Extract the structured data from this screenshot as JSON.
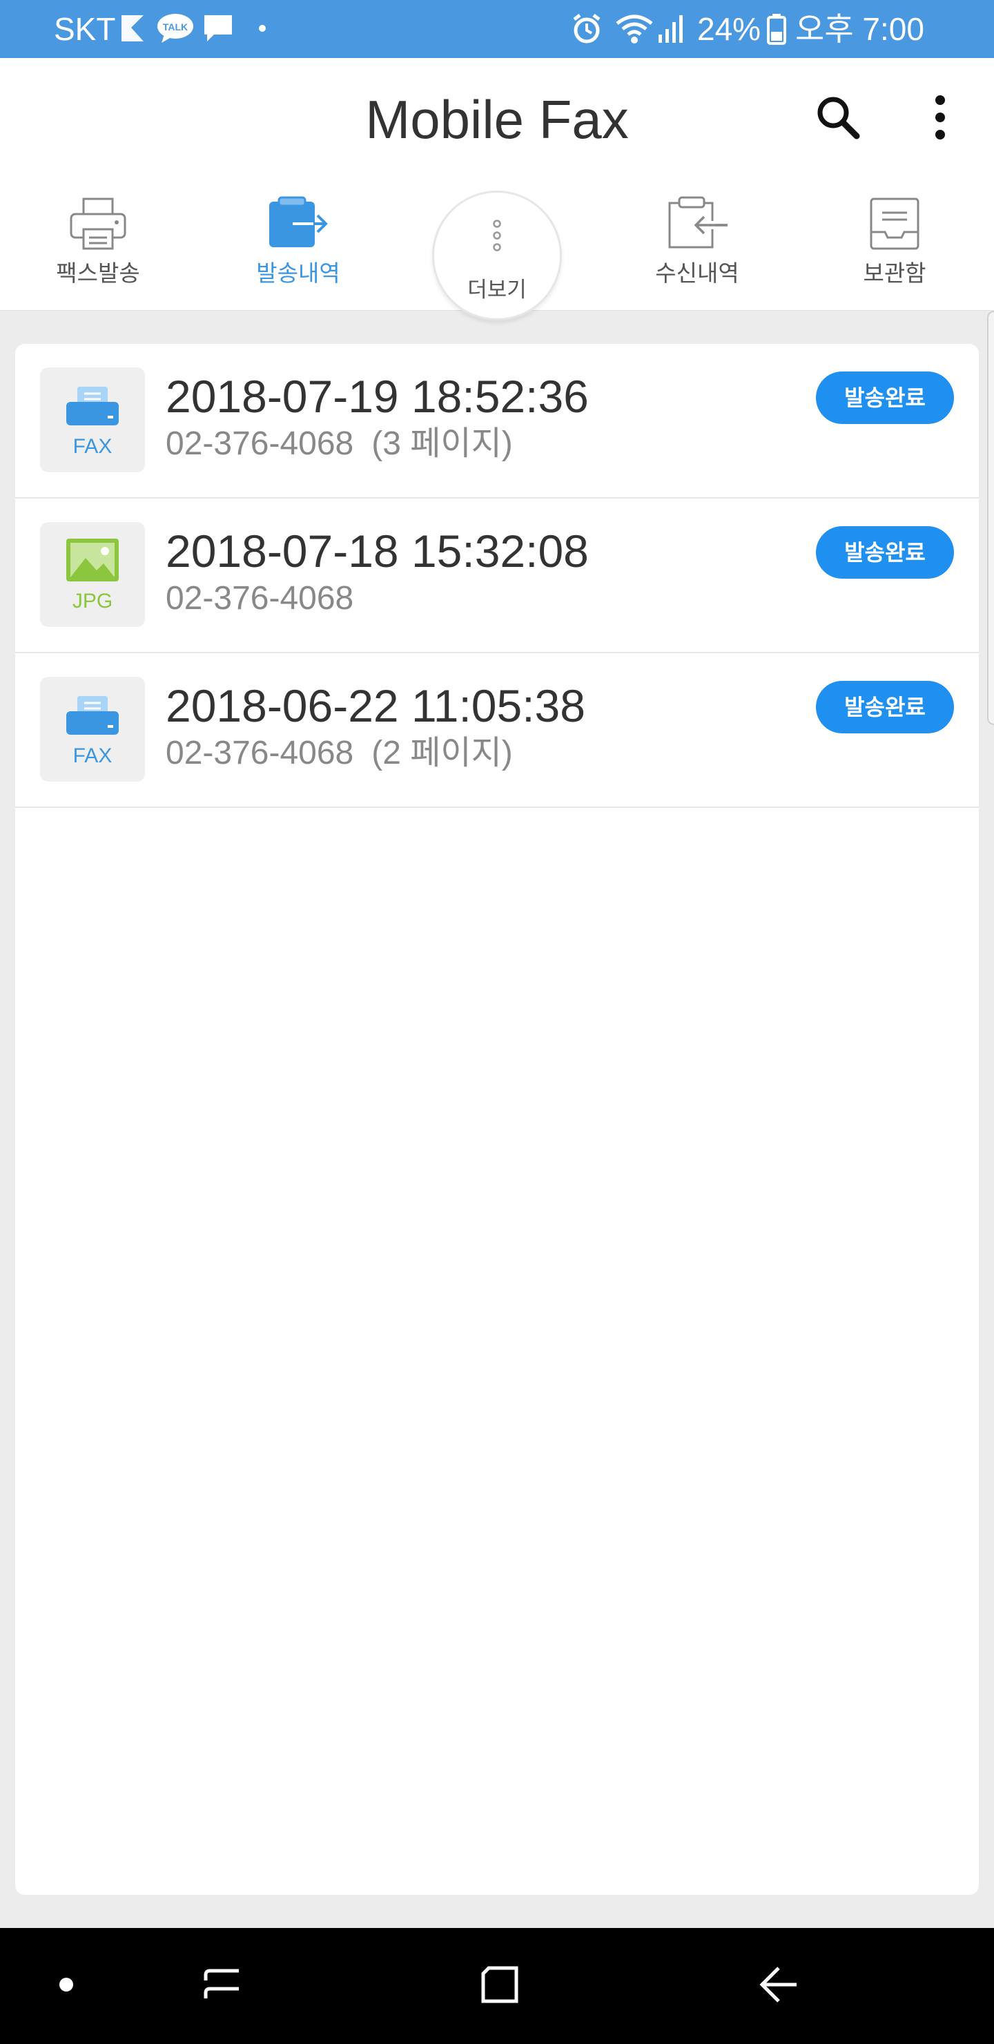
{
  "status_bar": {
    "carrier": "SKT",
    "battery": "24%",
    "time": "오후 7:00",
    "icons": [
      "k-icon",
      "talk-icon",
      "message-icon",
      "dot-icon",
      "alarm-icon",
      "wifi-icon",
      "signal-icon",
      "battery-icon"
    ]
  },
  "app_bar": {
    "title": "Mobile Fax",
    "icons": [
      "search-icon",
      "overflow-menu-icon"
    ]
  },
  "tabs": [
    {
      "label": "팩스발송",
      "icon": "printer-icon",
      "active": false
    },
    {
      "label": "발송내역",
      "icon": "sent-history-icon",
      "active": true
    },
    {
      "label": "더보기",
      "icon": "more-dots-icon",
      "active": false
    },
    {
      "label": "수신내역",
      "icon": "received-history-icon",
      "active": false
    },
    {
      "label": "보관함",
      "icon": "storage-box-icon",
      "active": false
    }
  ],
  "items": [
    {
      "type": "FAX",
      "datetime": "2018-07-19 18:52:36",
      "number": "02-376-4068",
      "pages": "(3 페이지)",
      "status": "발송완료"
    },
    {
      "type": "JPG",
      "datetime": "2018-07-18 15:32:08",
      "number": "02-376-4068",
      "pages": "",
      "status": "발송완료"
    },
    {
      "type": "FAX",
      "datetime": "2018-06-22 11:05:38",
      "number": "02-376-4068",
      "pages": "(2 페이지)",
      "status": "발송완료"
    }
  ],
  "colors": {
    "status_bar": "#4a98e0",
    "accent": "#3a96e0",
    "badge": "#1f8ff0",
    "fax_label": "#3a96e0",
    "jpg_label": "#8cc63f"
  },
  "nav_bar": {
    "icons": [
      "dot-icon",
      "recent-apps-icon",
      "home-icon",
      "back-icon"
    ]
  }
}
